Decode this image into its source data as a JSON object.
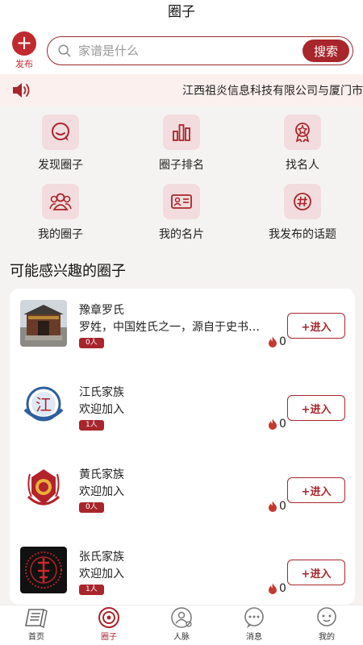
{
  "header": {
    "title": "圈子"
  },
  "publish": {
    "label": "发布"
  },
  "search": {
    "placeholder": "家谱是什么",
    "button_label": "搜索"
  },
  "notice": {
    "text": "江西祖炎信息科技有限公司与厦门市"
  },
  "features": [
    {
      "label": "发现圈子",
      "icon": "chat-bubble-icon"
    },
    {
      "label": "圈子排名",
      "icon": "bar-chart-icon"
    },
    {
      "label": "找名人",
      "icon": "award-medal-icon"
    },
    {
      "label": "我的圈子",
      "icon": "group-icon"
    },
    {
      "label": "我的名片",
      "icon": "id-card-icon"
    },
    {
      "label": "我发布的话题",
      "icon": "hashtag-icon"
    }
  ],
  "section": {
    "title": "可能感兴趣的圈子"
  },
  "circles": [
    {
      "name": "豫章罗氏",
      "desc": "罗姓，中国姓氏之一，源自于史书…",
      "members": "0人",
      "heat": "0",
      "join_label": "+进入",
      "avatar": "ancestral-hall-photo"
    },
    {
      "name": "江氏家族",
      "desc": "欢迎加入",
      "members": "1人",
      "heat": "0",
      "join_label": "+进入",
      "avatar": "jiang-emblem"
    },
    {
      "name": "黄氏家族",
      "desc": "欢迎加入",
      "members": "0人",
      "heat": "0",
      "join_label": "+进入",
      "avatar": "huang-emblem"
    },
    {
      "name": "张氏家族",
      "desc": "欢迎加入",
      "members": "1人",
      "heat": "0",
      "join_label": "+进入",
      "avatar": "zhang-emblem"
    }
  ],
  "tabs": [
    {
      "label": "首页",
      "icon": "book-icon",
      "active": false
    },
    {
      "label": "圈子",
      "icon": "circle-target-icon",
      "active": true
    },
    {
      "label": "人脉",
      "icon": "contacts-icon",
      "active": false
    },
    {
      "label": "消息",
      "icon": "message-icon",
      "active": false
    },
    {
      "label": "我的",
      "icon": "profile-icon",
      "active": false
    }
  ],
  "colors": {
    "brand": "#a8252b",
    "icon_bg": "#f3dcdd",
    "notice_bg": "#fcf0ee"
  }
}
